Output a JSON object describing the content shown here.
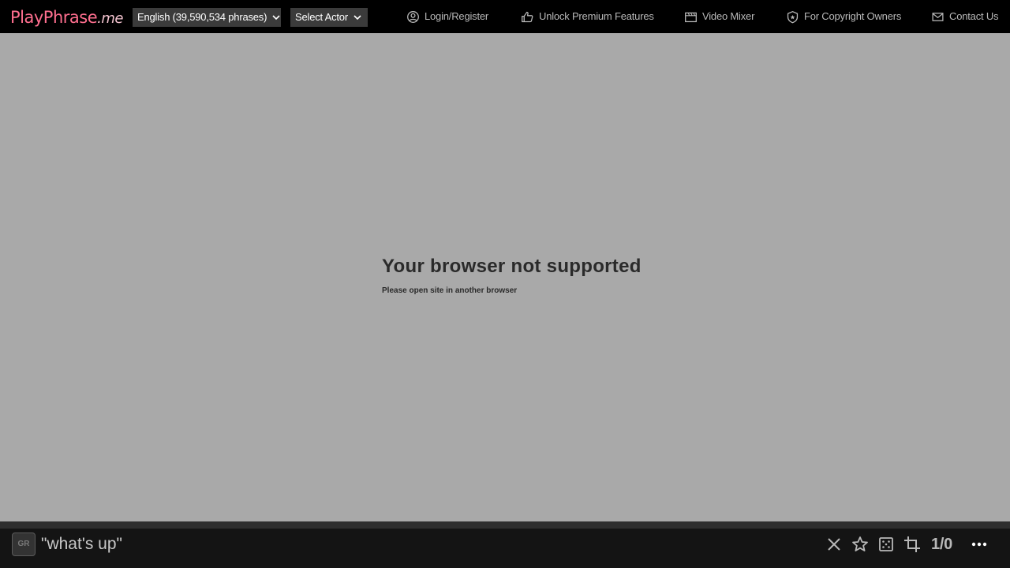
{
  "header": {
    "logo": {
      "part1": "PlayPhrase",
      "part2": ".me"
    },
    "language_dropdown": "English (39,590,534 phrases)",
    "actor_dropdown": "Select Actor",
    "nav": {
      "login": "Login/Register",
      "premium": "Unlock Premium Features",
      "mixer": "Video Mixer",
      "copyright": "For Copyright Owners",
      "contact": "Contact Us"
    }
  },
  "main": {
    "title": "Your browser not supported",
    "subtitle": "Please open site in another browser"
  },
  "bottom": {
    "gr_label": "GR",
    "search_value": "\"what's up\"",
    "counter": "1/0",
    "icons": [
      "close-icon",
      "star-icon",
      "dice-icon",
      "crop-icon",
      "more-icon"
    ]
  },
  "colors": {
    "background": "#a9a9a9",
    "topbar": "#000000",
    "bottombar": "#141414",
    "logo_accent": "#ff6f8f"
  }
}
